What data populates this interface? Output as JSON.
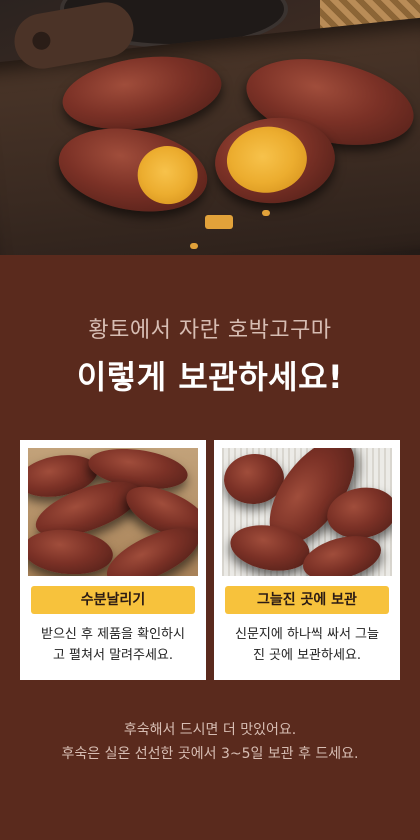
{
  "hero": {
    "image_description_icon": "roasted-sweet-potatoes-photo"
  },
  "heading": {
    "subtitle": "황토에서 자란 호박고구마",
    "title": "이렇게 보관하세요!"
  },
  "cards": [
    {
      "photo_icon": "sweet-potatoes-in-box-photo",
      "label": "수분날리기",
      "desc_line1": "받으신 후 제품을 확인하시",
      "desc_line2": "고 펼쳐서 말려주세요."
    },
    {
      "photo_icon": "sweet-potatoes-on-newspaper-photo",
      "label": "그늘진 곳에 보관",
      "desc_line1": "신문지에 하나씩 싸서 그늘",
      "desc_line2": "진 곳에 보관하세요."
    }
  ],
  "tip": {
    "line1": "후숙해서 드시면 더 맛있어요.",
    "line2": "후숙은 실온 선선한 곳에서 3~5일 보관 후 드세요."
  },
  "colors": {
    "background": "#5a2a1d",
    "label_bg": "#f7c23c",
    "title": "#ffffff",
    "subtitle": "#d7bdb3"
  }
}
